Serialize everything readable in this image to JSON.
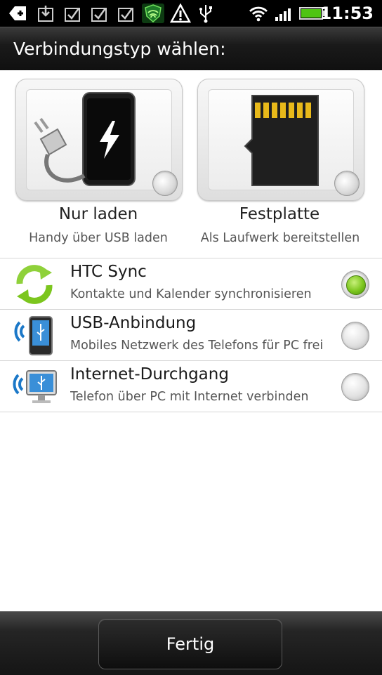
{
  "status_bar": {
    "icons": [
      "add-icon",
      "download-icon",
      "check-icon",
      "check-icon",
      "check-icon",
      "shield-icon",
      "warning-icon",
      "usb-icon",
      "wifi-icon",
      "signal-icon",
      "battery-icon"
    ],
    "time": "11:53"
  },
  "dialog": {
    "title": "Verbindungstyp wählen:"
  },
  "tiles": [
    {
      "title": "Nur laden",
      "subtitle": "Handy über USB laden",
      "selected": false
    },
    {
      "title": "Festplatte",
      "subtitle": "Als Laufwerk bereitstellen",
      "selected": false
    }
  ],
  "options": [
    {
      "title": "HTC Sync",
      "subtitle": "Kontakte und Kalender synchronisieren",
      "selected": true
    },
    {
      "title": "USB-Anbindung",
      "subtitle": "Mobiles Netzwerk des Telefons für PC frei",
      "selected": false
    },
    {
      "title": "Internet-Durchgang",
      "subtitle": "Telefon über PC mit Internet verbinden",
      "selected": false
    }
  ],
  "footer": {
    "done_label": "Fertig"
  },
  "colors": {
    "accent_green": "#7cc61e",
    "titlebar": "#1a1a1a"
  }
}
